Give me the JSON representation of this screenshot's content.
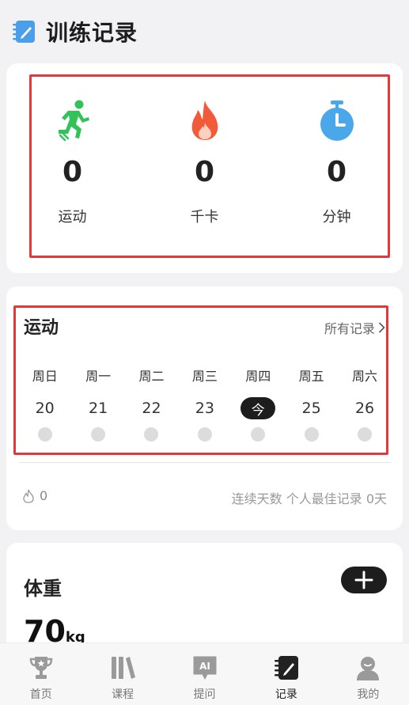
{
  "header": {
    "title": "训练记录",
    "icon": "notebook-pen-icon"
  },
  "summary": {
    "stats": [
      {
        "icon": "running-person-icon",
        "value": "0",
        "label": "运动",
        "color": "#33c25a"
      },
      {
        "icon": "flame-icon",
        "value": "0",
        "label": "千卡",
        "color": "#f25b3a"
      },
      {
        "icon": "stopwatch-icon",
        "value": "0",
        "label": "分钟",
        "color": "#4aa8ea"
      }
    ]
  },
  "exercise": {
    "title": "运动",
    "all_records": "所有记录",
    "days": [
      {
        "name": "周日",
        "num": "20"
      },
      {
        "name": "周一",
        "num": "21"
      },
      {
        "name": "周二",
        "num": "22"
      },
      {
        "name": "周三",
        "num": "23"
      },
      {
        "name": "周四",
        "num": "今",
        "today": true
      },
      {
        "name": "周五",
        "num": "25"
      },
      {
        "name": "周六",
        "num": "26"
      }
    ],
    "streak_count": "0",
    "streak_text": "连续天数 个人最佳记录 0天"
  },
  "weight": {
    "title": "体重",
    "value": "70",
    "unit": "kg"
  },
  "tabbar": {
    "tabs": [
      {
        "label": "首页",
        "icon": "trophy-icon"
      },
      {
        "label": "课程",
        "icon": "books-icon"
      },
      {
        "label": "提问",
        "icon": "ai-chat-icon"
      },
      {
        "label": "记录",
        "icon": "notebook-pen-icon",
        "active": true
      },
      {
        "label": "我的",
        "icon": "user-avatar-icon"
      }
    ]
  }
}
